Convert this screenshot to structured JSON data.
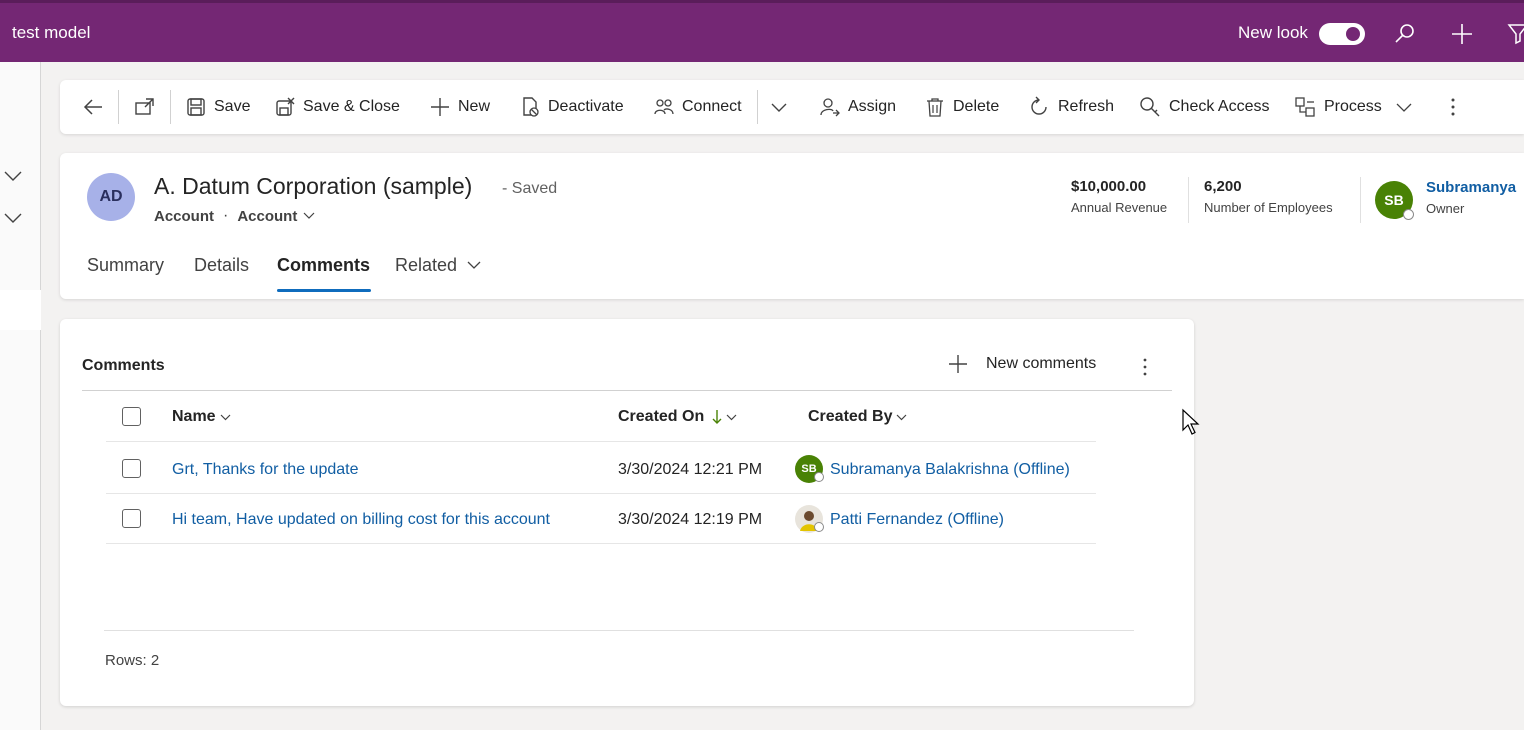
{
  "app": {
    "title": "test model",
    "new_look_label": "New look",
    "new_look_on": true
  },
  "commands": {
    "save": "Save",
    "save_close": "Save & Close",
    "new": "New",
    "deactivate": "Deactivate",
    "connect": "Connect",
    "assign": "Assign",
    "delete": "Delete",
    "refresh": "Refresh",
    "check_access": "Check Access",
    "process": "Process"
  },
  "record": {
    "initials": "AD",
    "title": "A. Datum Corporation (sample)",
    "status": "- Saved",
    "entity": "Account",
    "form": "Account",
    "separator": "·"
  },
  "metrics": [
    {
      "value": "$10,000.00",
      "label": "Annual Revenue"
    },
    {
      "value": "6,200",
      "label": "Number of Employees"
    }
  ],
  "owner": {
    "initials": "SB",
    "name": "Subramanya",
    "label": "Owner"
  },
  "tabs": [
    "Summary",
    "Details",
    "Comments",
    "Related"
  ],
  "comments": {
    "section_title": "Comments",
    "new_button": "New comments",
    "columns": {
      "name": "Name",
      "created_on": "Created On",
      "created_by": "Created By"
    },
    "rows": [
      {
        "name": "Grt, Thanks for the update",
        "created_on": "3/30/2024 12:21 PM",
        "created_by": "Subramanya Balakrishna (Offline)",
        "avatar_initials": "SB"
      },
      {
        "name": "Hi team, Have updated on billing cost for this account",
        "created_on": "3/30/2024 12:19 PM",
        "created_by": "Patti Fernandez (Offline)",
        "avatar_initials": ""
      }
    ],
    "rows_label": "Rows: 2"
  },
  "colors": {
    "topbar": "#742774",
    "link": "#115ea3",
    "accent": "#0f6cbd",
    "owner_avatar": "#498205",
    "record_avatar": "#a7b1e8"
  }
}
